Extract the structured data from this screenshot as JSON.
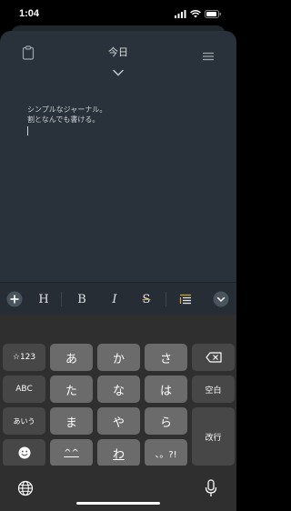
{
  "status": {
    "time": "1:04"
  },
  "header": {
    "title": "今日"
  },
  "editor": {
    "lines": [
      "シンプルなジャーナル。",
      "割となんでも書ける。"
    ]
  },
  "format_toolbar": {
    "heading_label": "H",
    "bold_label": "B",
    "italic_label": "I",
    "strike_label": "S"
  },
  "keyboard": {
    "mode_key": "☆123",
    "abc_key": "ABC",
    "kana_key": "あいう",
    "a_key": "あ",
    "ka_key": "か",
    "sa_key": "さ",
    "ta_key": "た",
    "na_key": "な",
    "ha_key": "は",
    "ma_key": "ま",
    "ya_key": "や",
    "ra_key": "ら",
    "small_key": "^^",
    "wa_key": "わ",
    "punct_key": "、。?!",
    "space_key": "空白",
    "enter_key": "改行"
  },
  "colors": {
    "sheet": "#29323a",
    "toolbar": "#262d34",
    "accent": "#c4a53d"
  }
}
